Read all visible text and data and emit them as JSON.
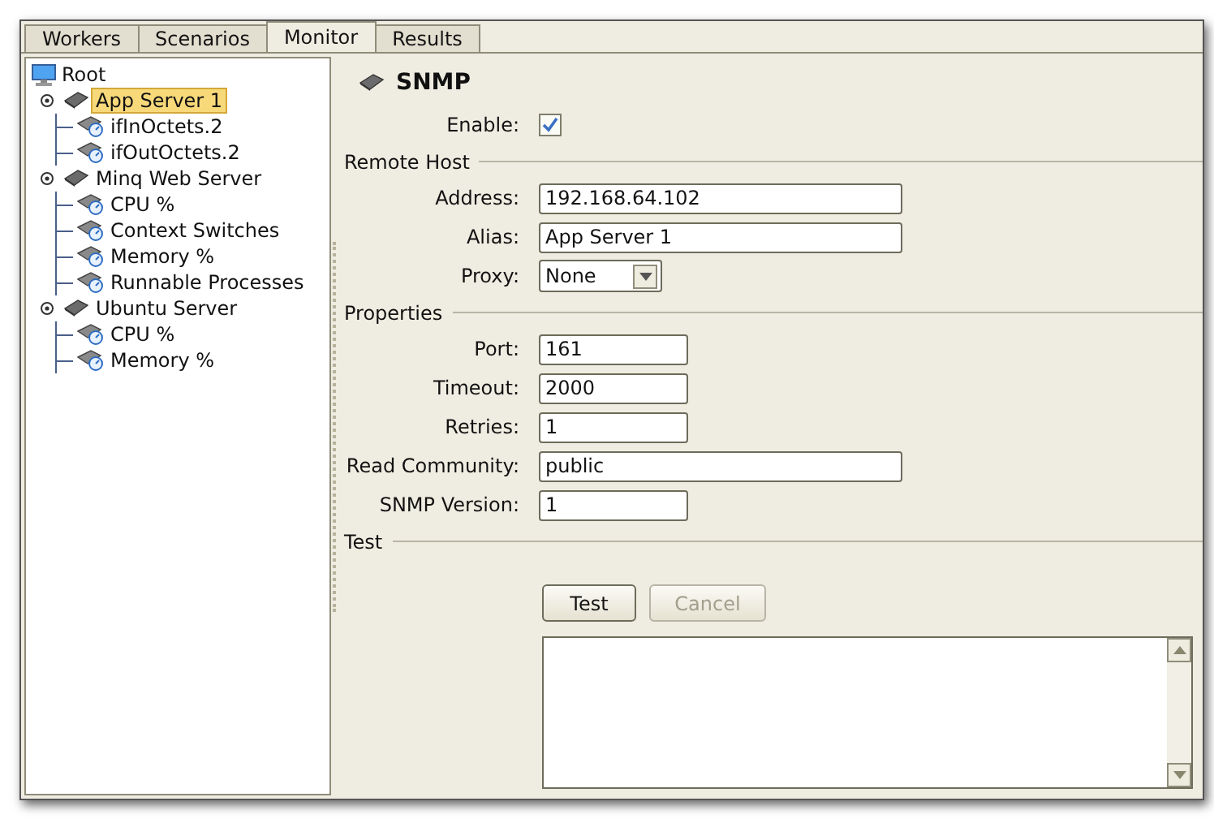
{
  "tabs": [
    {
      "label": "Workers",
      "selected": false
    },
    {
      "label": "Scenarios",
      "selected": false
    },
    {
      "label": "Monitor",
      "selected": true
    },
    {
      "label": "Results",
      "selected": false
    }
  ],
  "tree": {
    "label": "Root",
    "kind": "root",
    "children": [
      {
        "label": "App Server 1",
        "kind": "server",
        "expanded": true,
        "selected": true,
        "children": [
          {
            "label": "ifInOctets.2",
            "kind": "metric",
            "selected": false
          },
          {
            "label": "ifOutOctets.2",
            "kind": "metric",
            "selected": false
          }
        ]
      },
      {
        "label": "Minq Web Server",
        "kind": "server",
        "expanded": true,
        "selected": false,
        "children": [
          {
            "label": "CPU %",
            "kind": "metric",
            "selected": false
          },
          {
            "label": "Context Switches",
            "kind": "metric",
            "selected": false
          },
          {
            "label": "Memory %",
            "kind": "metric",
            "selected": false
          },
          {
            "label": "Runnable Processes",
            "kind": "metric",
            "selected": false
          }
        ]
      },
      {
        "label": "Ubuntu Server",
        "kind": "server",
        "expanded": true,
        "selected": false,
        "children": [
          {
            "label": "CPU %",
            "kind": "metric",
            "selected": false
          },
          {
            "label": "Memory %",
            "kind": "metric",
            "selected": false
          }
        ]
      }
    ]
  },
  "form": {
    "title": "SNMP",
    "enable": {
      "label": "Enable:",
      "checked": true
    },
    "sections": [
      {
        "title": "Remote Host",
        "rows": [
          {
            "kind": "long_text",
            "label": "Address:",
            "value": "192.168.64.102"
          },
          {
            "kind": "long_text",
            "label": "Alias:",
            "value": "App Server 1"
          },
          {
            "kind": "combo",
            "label": "Proxy:",
            "value": "None"
          }
        ]
      },
      {
        "title": "Properties",
        "rows": [
          {
            "kind": "short_text",
            "label": "Port:",
            "value": "161"
          },
          {
            "kind": "short_text",
            "label": "Timeout:",
            "value": "2000"
          },
          {
            "kind": "short_text",
            "label": "Retries:",
            "value": "1"
          },
          {
            "kind": "long_text",
            "label": "Read Community:",
            "value": "public"
          },
          {
            "kind": "short_text",
            "label": "SNMP Version:",
            "value": "1"
          }
        ]
      },
      {
        "title": "Test"
      }
    ],
    "buttons": [
      {
        "label": "Test",
        "disabled": false
      },
      {
        "label": "Cancel",
        "disabled": true
      }
    ]
  }
}
